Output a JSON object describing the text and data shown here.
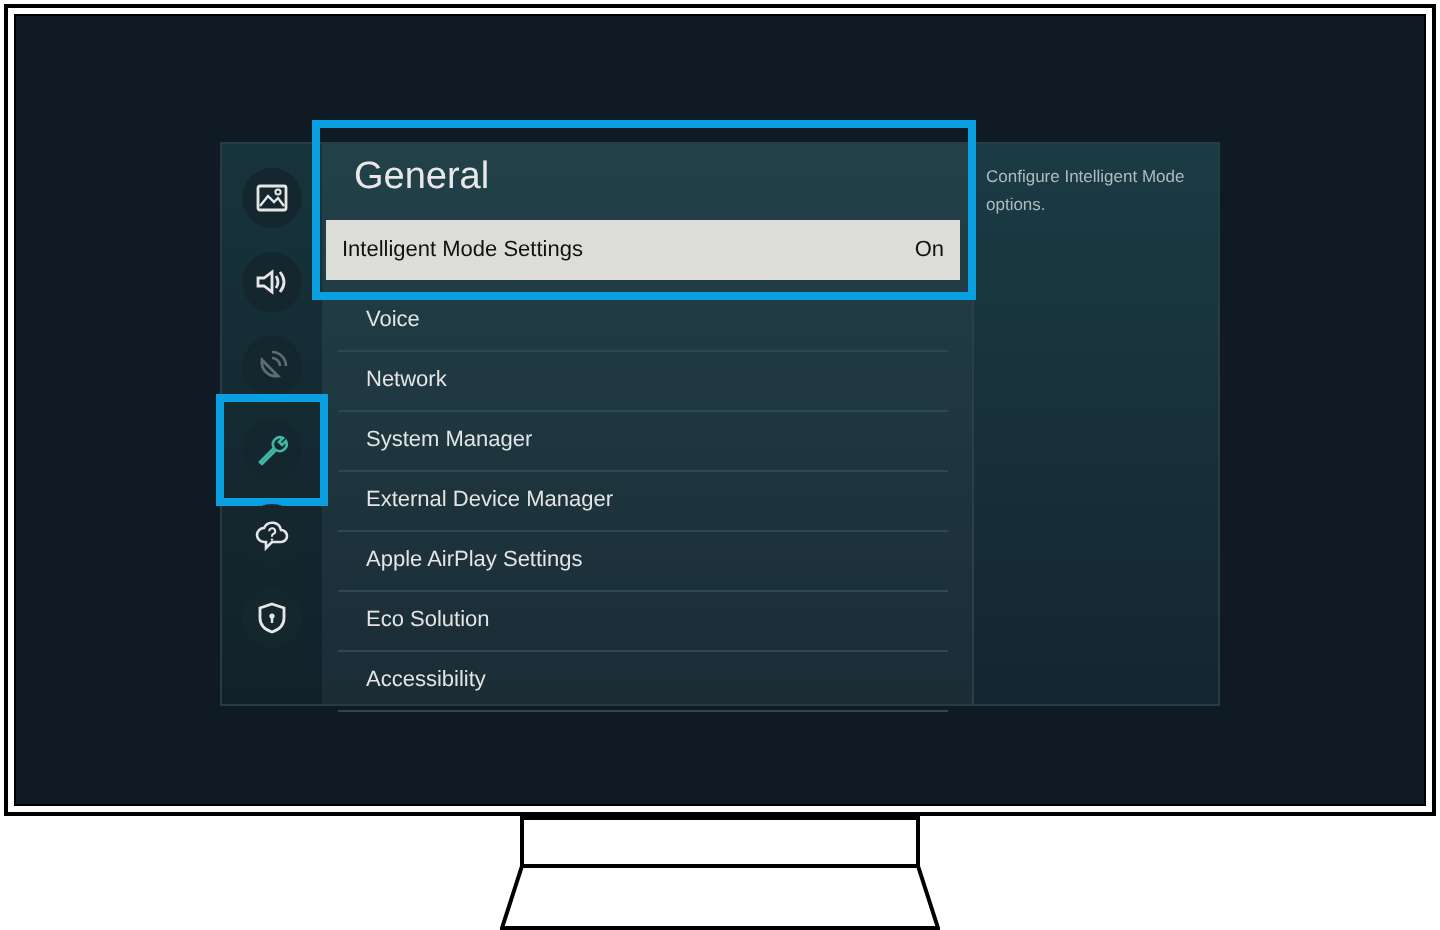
{
  "sidebar": {
    "items": [
      {
        "kind": "picture",
        "selected": false,
        "disabled": false,
        "outlined": false
      },
      {
        "kind": "sound",
        "selected": false,
        "disabled": false,
        "outlined": false
      },
      {
        "kind": "broadcast",
        "selected": false,
        "disabled": true,
        "outlined": false
      },
      {
        "kind": "general",
        "selected": true,
        "disabled": false,
        "outlined": true
      },
      {
        "kind": "support",
        "selected": false,
        "disabled": false,
        "outlined": false
      },
      {
        "kind": "privacy",
        "selected": false,
        "disabled": false,
        "outlined": false
      }
    ]
  },
  "menu": {
    "title": "General",
    "outlined": true,
    "items": [
      {
        "label": "Intelligent Mode Settings",
        "value": "On",
        "selected": true
      },
      {
        "label": "Voice",
        "selected": false
      },
      {
        "label": "Network",
        "selected": false
      },
      {
        "label": "System Manager",
        "selected": false
      },
      {
        "label": "External Device Manager",
        "selected": false
      },
      {
        "label": "Apple AirPlay Settings",
        "selected": false
      },
      {
        "label": "Eco Solution",
        "selected": false
      },
      {
        "label": "Accessibility",
        "selected": false
      }
    ]
  },
  "description": "Configure Intelligent Mode options."
}
